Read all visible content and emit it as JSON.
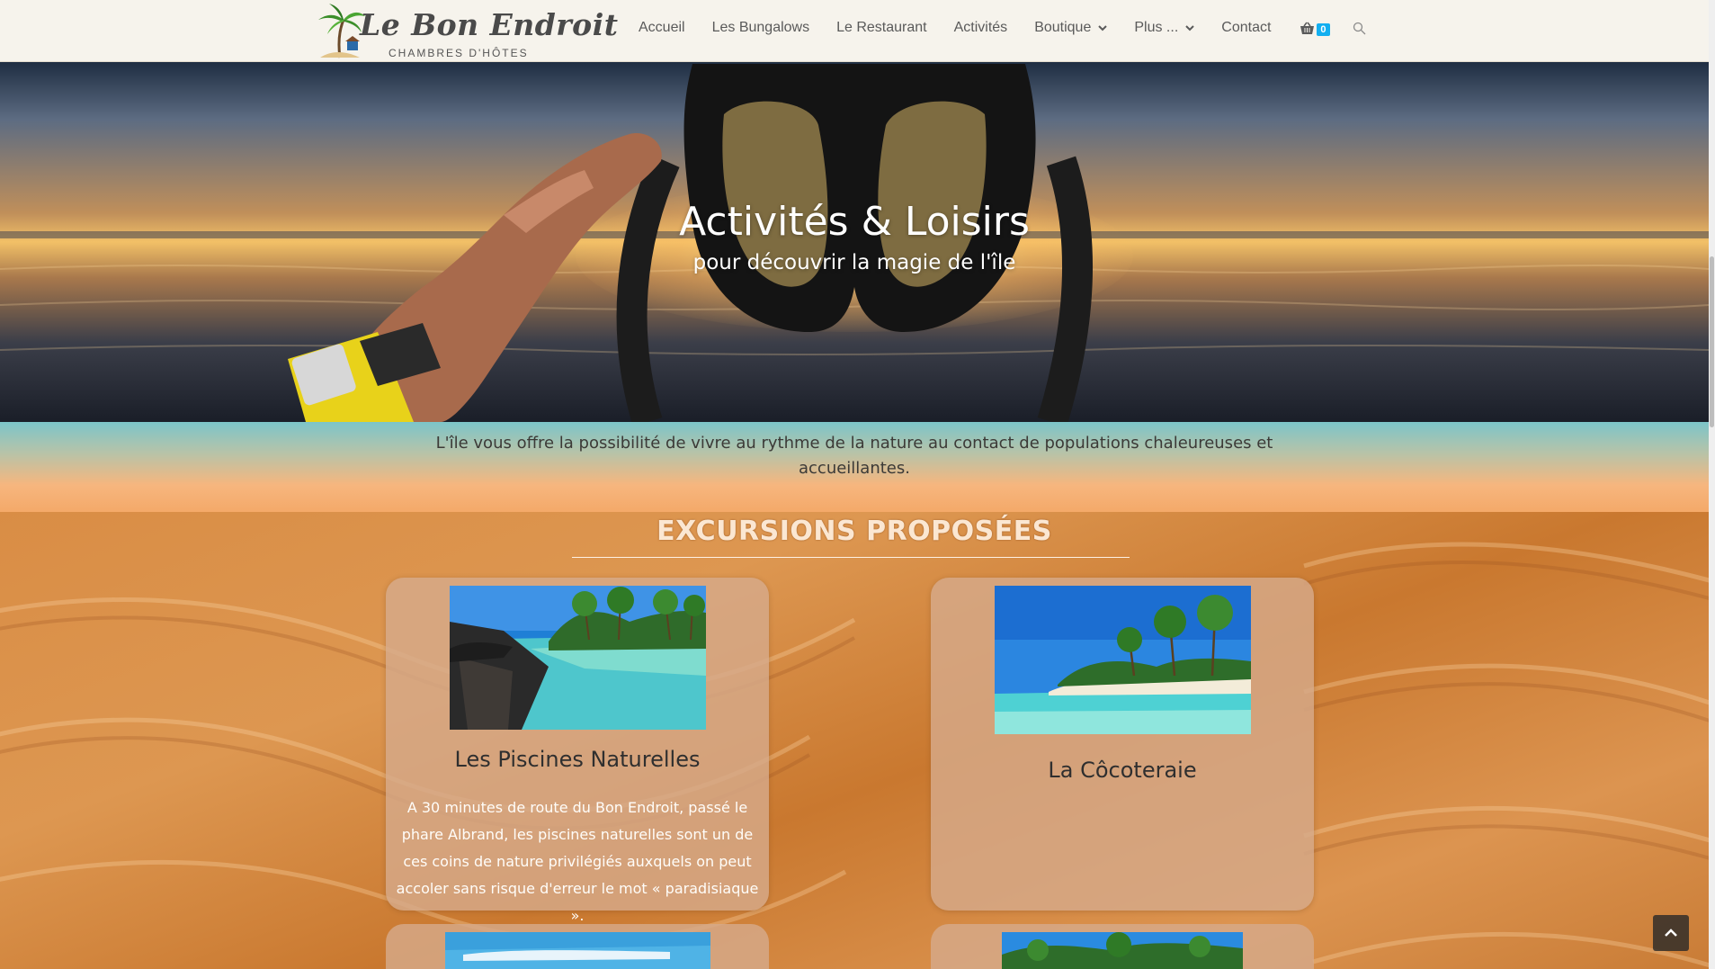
{
  "logo": {
    "title": "Le Bon Endroit",
    "subtitle": "CHAMBRES D'HÔTES"
  },
  "nav": {
    "items": [
      "Accueil",
      "Les Bungalows",
      "Le Restaurant",
      "Activités",
      "Boutique",
      "Plus ...",
      "Contact"
    ],
    "cart_count": "0",
    "icons": {
      "cart": "basket-icon",
      "search": "search-icon",
      "dropdown": "chevron-down-icon"
    }
  },
  "hero": {
    "title": "Activités & Loisirs",
    "subtitle": "pour découvrir la magie de l'île"
  },
  "intro": {
    "text": "L'île vous offre la possibilité de vivre au rythme de la nature au contact de populations chaleureuses et accueillantes."
  },
  "section": {
    "title": "EXCURSIONS PROPOSÉES"
  },
  "cards": [
    {
      "title": "Les Piscines Naturelles",
      "text": "A 30 minutes de route du Bon Endroit, passé le phare Albrand, les piscines naturelles sont un de ces coins de nature privilégiés auxquels on peut accoler sans risque d'erreur le mot « paradisiaque »."
    },
    {
      "title": "La Côcoteraie",
      "text": ""
    }
  ],
  "icons": {
    "back_to_top": "chevron-up-icon"
  },
  "colors": {
    "badge": "#13aff0",
    "header_bg": "#f6f3ec"
  }
}
